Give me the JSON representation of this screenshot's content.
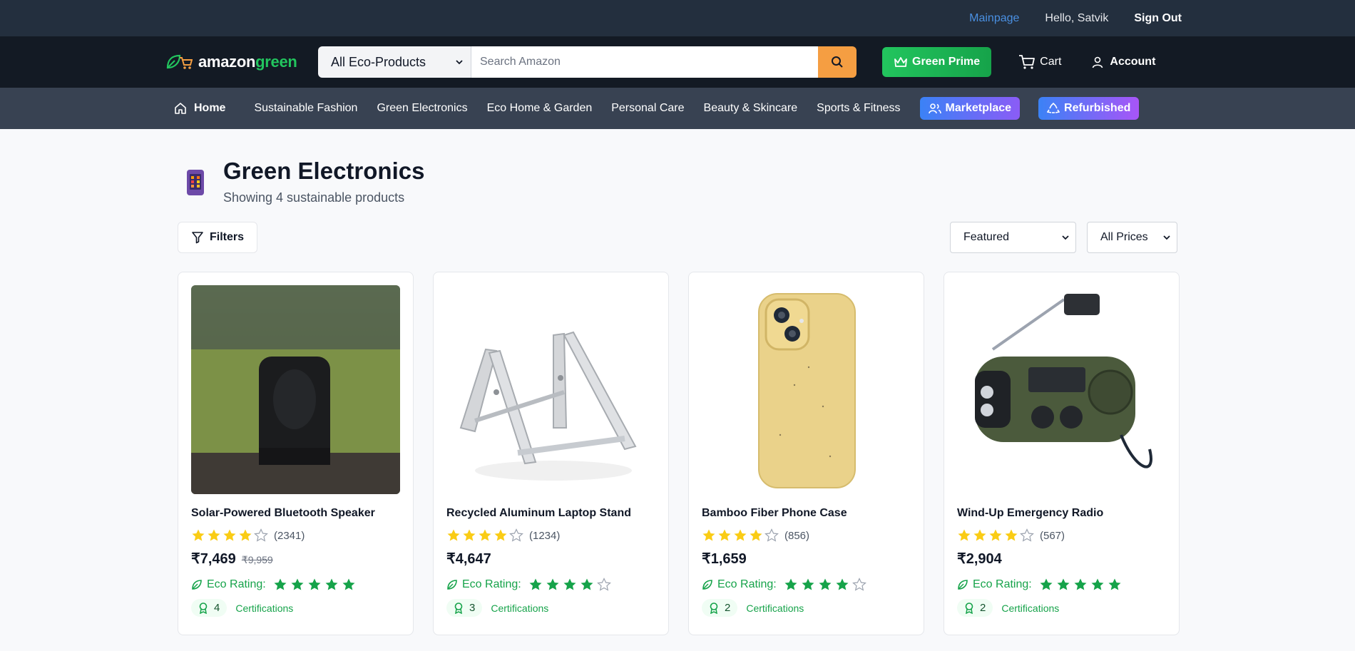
{
  "topbar": {
    "mainpage": "Mainpage",
    "hello": "Hello, Satvik",
    "signout": "Sign Out"
  },
  "header": {
    "logo_a": "amazon",
    "logo_b": "green",
    "category_select": "All Eco-Products",
    "search_placeholder": "Search Amazon",
    "prime": "Green Prime",
    "cart": "Cart",
    "account": "Account"
  },
  "nav": {
    "home": "Home",
    "items": [
      "Sustainable Fashion",
      "Green Electronics",
      "Eco Home & Garden",
      "Personal Care",
      "Beauty & Skincare",
      "Sports & Fitness"
    ],
    "marketplace": "Marketplace",
    "refurbished": "Refurbished"
  },
  "page": {
    "title": "Green Electronics",
    "subtitle": "Showing 4 sustainable products",
    "filters": "Filters",
    "sort": "Featured",
    "price_filter": "All Prices"
  },
  "eco_label": "Eco Rating:",
  "cert_label": "Certifications",
  "colors": {
    "accent_green": "#16a34a",
    "star_yellow": "#facc15",
    "search_orange": "#f59e42"
  },
  "products": [
    {
      "name": "Solar-Powered Bluetooth Speaker",
      "stars": 4,
      "reviews": "(2341)",
      "price": "₹7,469",
      "original": "₹9,959",
      "eco": 5,
      "certs": "4",
      "image": "speaker-photo"
    },
    {
      "name": "Recycled Aluminum Laptop Stand",
      "stars": 4,
      "reviews": "(1234)",
      "price": "₹4,647",
      "original": "",
      "eco": 4,
      "certs": "3",
      "image": "laptop-stand-photo"
    },
    {
      "name": "Bamboo Fiber Phone Case",
      "stars": 4,
      "reviews": "(856)",
      "price": "₹1,659",
      "original": "",
      "eco": 4,
      "certs": "2",
      "image": "phone-case-photo"
    },
    {
      "name": "Wind-Up Emergency Radio",
      "stars": 4,
      "reviews": "(567)",
      "price": "₹2,904",
      "original": "",
      "eco": 5,
      "certs": "2",
      "image": "radio-photo"
    }
  ]
}
